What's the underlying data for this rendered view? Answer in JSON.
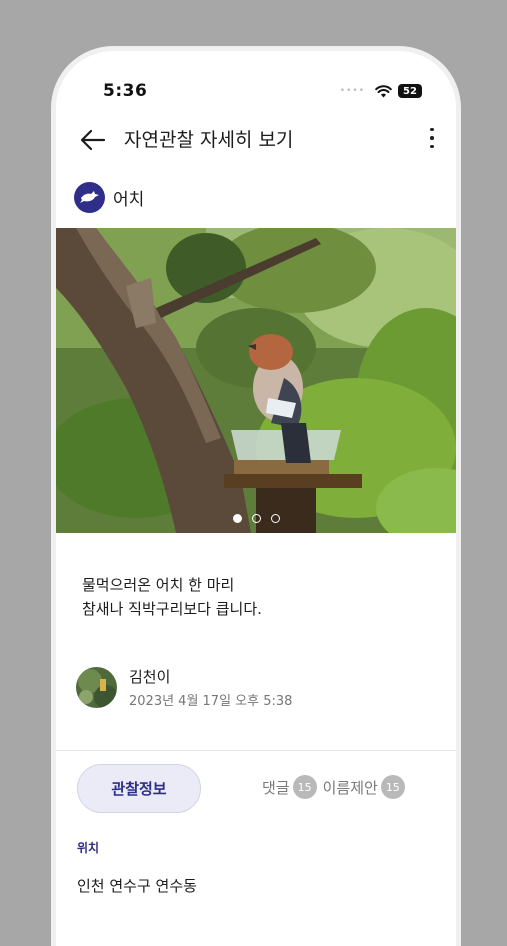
{
  "status_bar": {
    "time": "5:36",
    "battery": "52"
  },
  "header": {
    "title": "자연관찰 자세히 보기"
  },
  "species": {
    "name": "어치"
  },
  "photo": {
    "slide_current": 1,
    "slide_total": 3
  },
  "post": {
    "description_lines": [
      "물먹으러온 어치 한 마리",
      "참새나 직박구리보다 큽니다."
    ]
  },
  "author": {
    "name": "김천이",
    "date": "2023년 4월 17일 오후 5:38"
  },
  "tabs": {
    "observation": "관찰정보",
    "comments": "댓글",
    "comments_count": "15",
    "name_suggest": "이름제안",
    "name_suggest_count": "15"
  },
  "details": {
    "location_label": "위치",
    "location_value": "인천 연수구 연수동"
  },
  "colors": {
    "accent": "#2d2e86",
    "accent_bg": "#ebebf7"
  }
}
